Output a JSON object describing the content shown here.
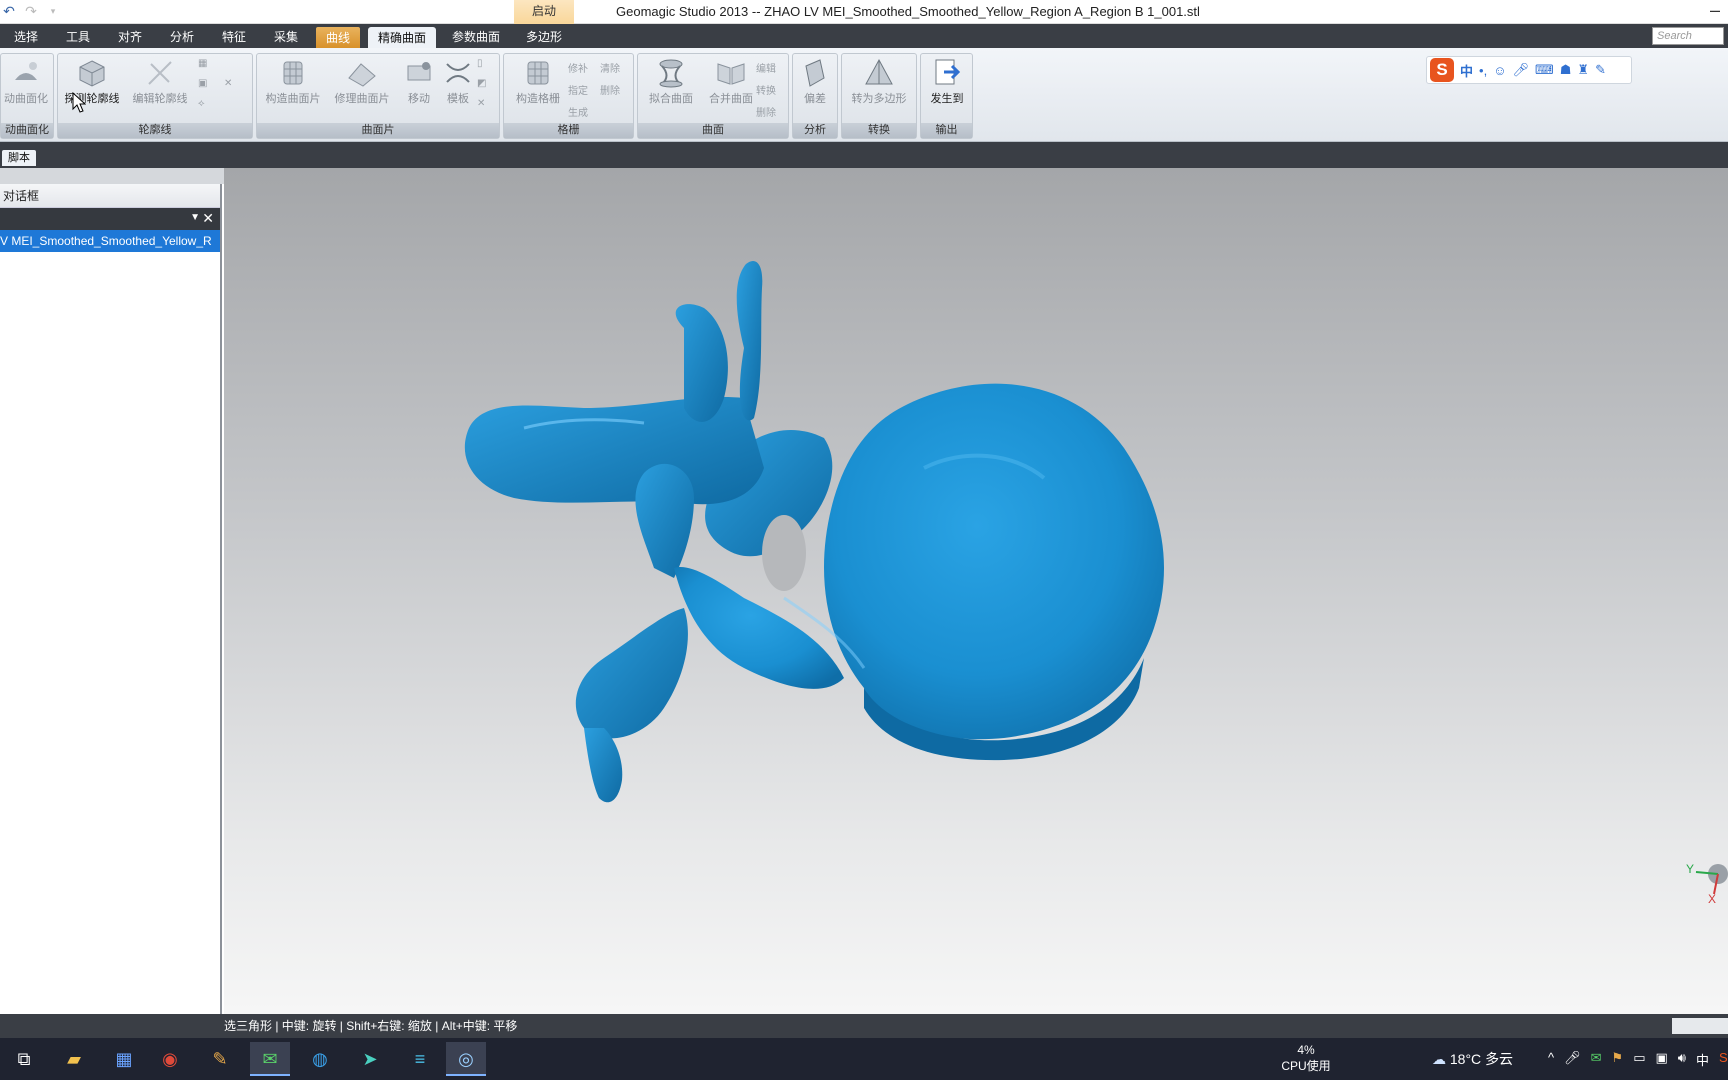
{
  "window": {
    "title": "Geomagic Studio 2013 -- ZHAO LV MEI_Smoothed_Smoothed_Yellow_Region A_Region B 1_001.stl",
    "context_tab": "启动",
    "minimize": "–"
  },
  "menu": {
    "tabs": [
      "选择",
      "工具",
      "对齐",
      "分析",
      "特征",
      "采集",
      "曲线",
      "精确曲面",
      "参数曲面",
      "多边形"
    ],
    "search_placeholder": "Search"
  },
  "ribbon": {
    "groups": [
      {
        "label": "动曲面化",
        "buttons": [
          "动曲面化"
        ]
      },
      {
        "label": "轮廓线",
        "buttons": [
          "探测轮廓线",
          "编辑轮廓线"
        ]
      },
      {
        "label": "曲面片",
        "buttons": [
          "构造曲面片",
          "修理曲面片",
          "移动",
          "模板"
        ]
      },
      {
        "label": "格栅",
        "buttons": [
          "构造格栅"
        ],
        "small": [
          "修补",
          "清除",
          "指定",
          "删除",
          "生成"
        ]
      },
      {
        "label": "曲面",
        "buttons": [
          "拟合曲面",
          "合并曲面"
        ],
        "small": [
          "编辑",
          "转换",
          "删除"
        ]
      },
      {
        "label": "分析",
        "buttons": [
          "偏差"
        ]
      },
      {
        "label": "转换",
        "buttons": [
          "转为多边形"
        ]
      },
      {
        "label": "输出",
        "buttons": [
          "发生到"
        ]
      }
    ]
  },
  "ime": {
    "mode": "中",
    "punct": "•,"
  },
  "script_tab": "脚本",
  "panel": {
    "header": "对话框",
    "selected_item": "V MEI_Smoothed_Smoothed_Yellow_R"
  },
  "statusbar": {
    "text": "选三角形 | 中键: 旋转 | Shift+右键: 缩放 | Alt+中键: 平移"
  },
  "axes": {
    "y": "Y",
    "x": "X"
  },
  "taskbar": {
    "cpu_percent": "4%",
    "cpu_label": "CPU使用",
    "temperature": "18°C",
    "weather": "多云",
    "ime": "中"
  },
  "colors": {
    "model_blue": "#1a8fd1",
    "accent": "#1e78d7",
    "dark_chrome": "#3a3e45"
  }
}
